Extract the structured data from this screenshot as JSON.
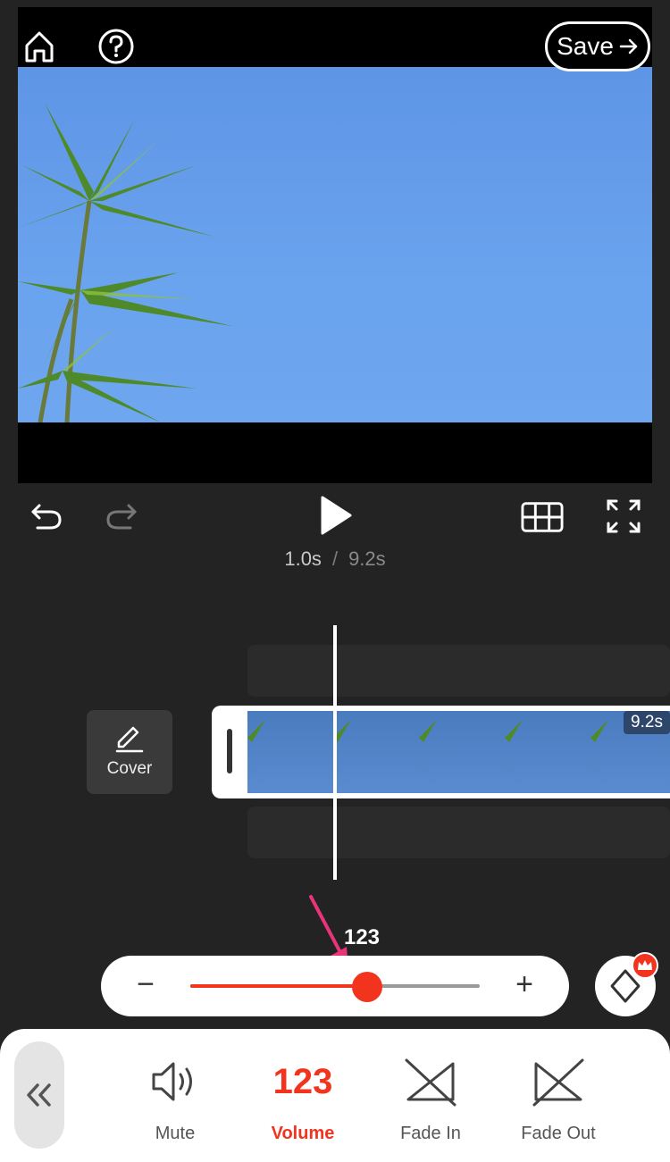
{
  "header": {
    "save_label": "Save"
  },
  "icons": {
    "home": "home-icon",
    "help": "help-icon",
    "undo": "undo-icon",
    "redo": "redo-icon",
    "play": "play-icon",
    "grid": "grid-icon",
    "fullscreen": "fullscreen-icon"
  },
  "playback": {
    "current_time": "1.0s",
    "separator": "/",
    "total_time": "9.2s"
  },
  "timeline": {
    "cover_label": "Cover",
    "clip_duration": "9.2s"
  },
  "volume": {
    "value": "123",
    "level_fraction": 0.61,
    "minus": "−",
    "plus": "+"
  },
  "toolbar": {
    "items": [
      {
        "label": "Mute",
        "icon": "speaker-icon"
      },
      {
        "label": "Volume",
        "icon": "volume-value",
        "value": "123"
      },
      {
        "label": "Fade In",
        "icon": "fade-in-icon"
      },
      {
        "label": "Fade Out",
        "icon": "fade-out-icon"
      }
    ]
  },
  "colors": {
    "accent": "#f2341f",
    "background": "#232323",
    "sky": "#6aa3ee"
  }
}
